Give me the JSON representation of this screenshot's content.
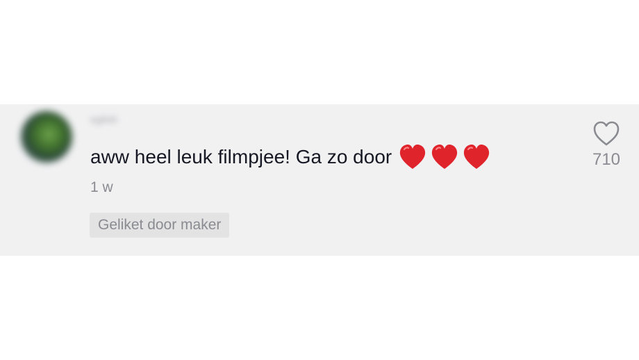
{
  "comment": {
    "username": "eglish",
    "text": "aww heel leuk filmpjee! Ga zo door",
    "emojis": [
      "red-heart",
      "red-heart",
      "red-heart"
    ],
    "timestamp": "1 w",
    "liked_badge": "Geliket door maker",
    "like_count": "710"
  },
  "colors": {
    "card_background": "#f1f1f2",
    "text_primary": "#161823",
    "text_secondary": "#8a8b91",
    "heart_red": "#e0242c"
  },
  "icons": {
    "like": "heart-outline-icon",
    "emoji": "red-heart-emoji"
  }
}
